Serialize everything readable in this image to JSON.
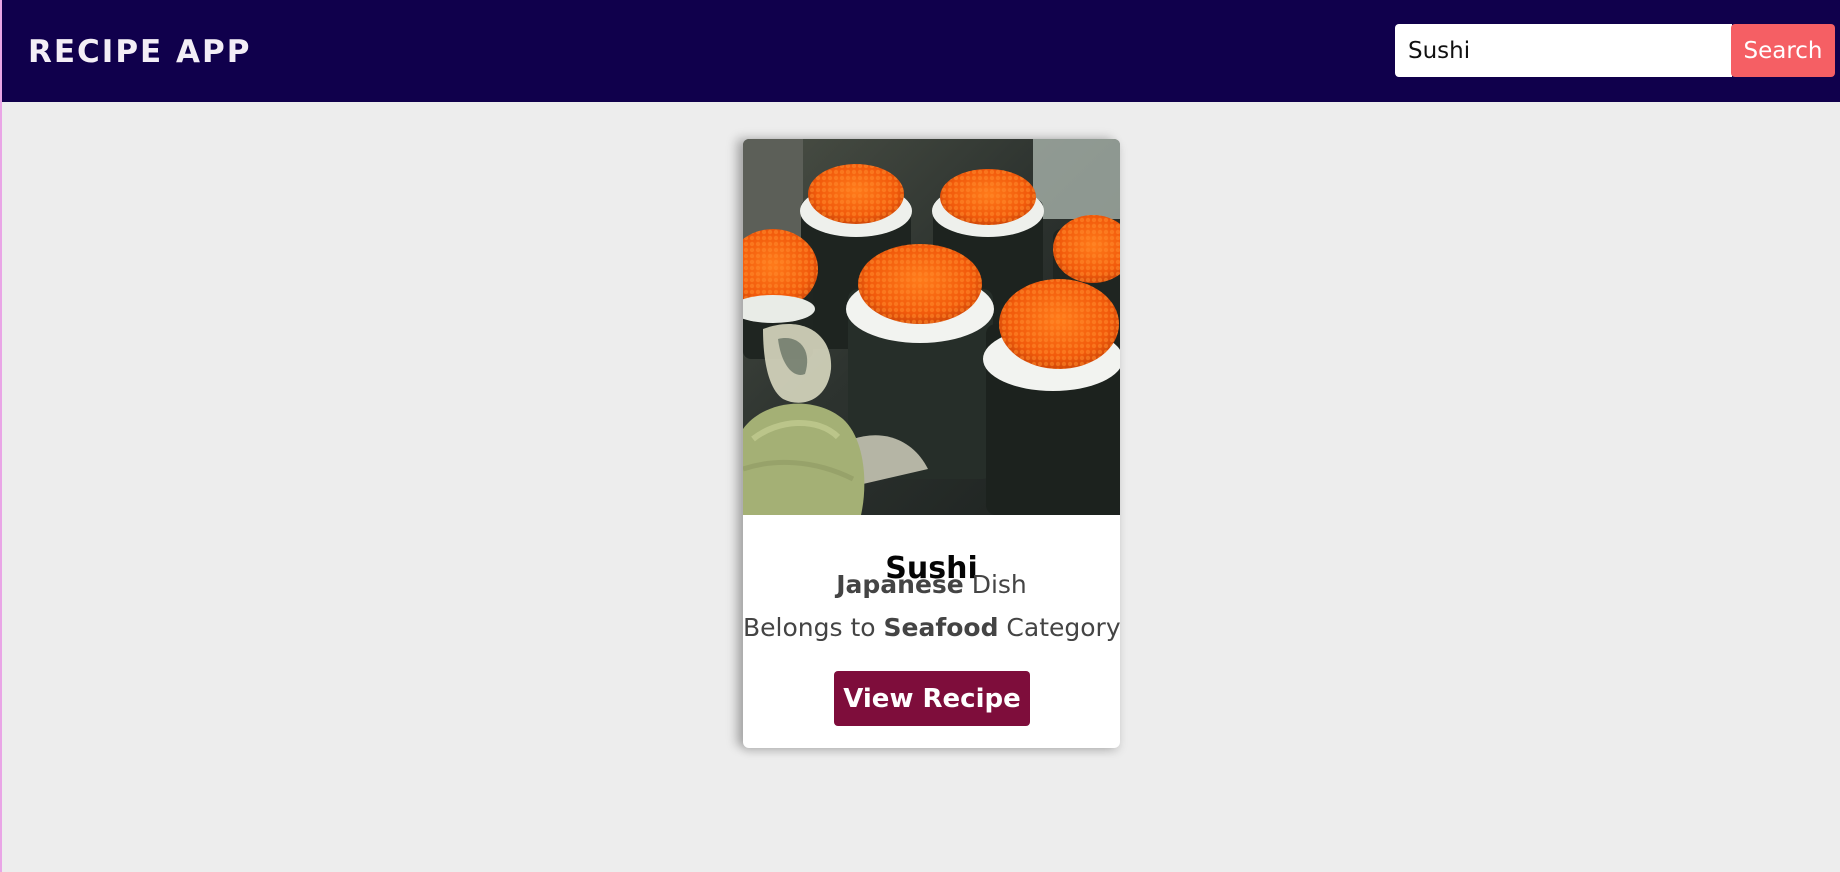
{
  "header": {
    "brand": "RECIPE APP",
    "search": {
      "value": "Sushi",
      "placeholder": "",
      "button_label": "Search"
    }
  },
  "results": [
    {
      "image": "sushi-photo",
      "name": "Sushi",
      "area": "Japanese",
      "area_suffix": " Dish",
      "category_prefix": "Belongs to ",
      "category": "Seafood",
      "category_suffix": " Category",
      "button_label": "View Recipe"
    }
  ],
  "colors": {
    "header_bg": "#10004c",
    "page_bg": "#ededed",
    "search_button": "#f55f64",
    "view_button": "#7e0d3b"
  }
}
